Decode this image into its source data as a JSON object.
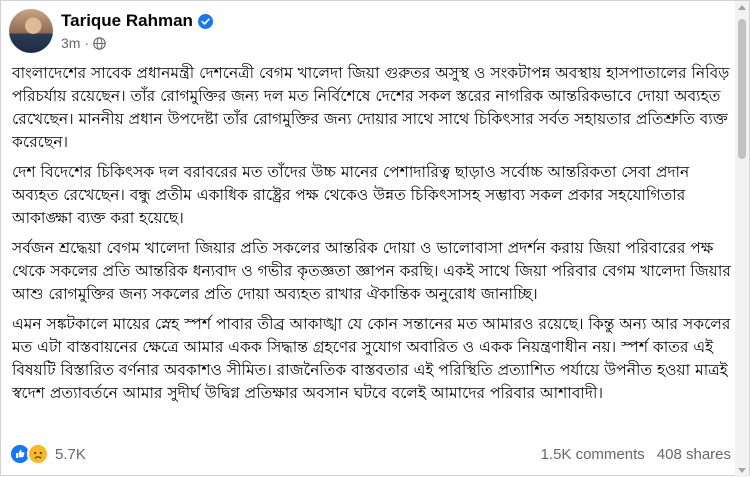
{
  "post": {
    "author": "Tarique Rahman",
    "time": "3m",
    "separator": "·",
    "paragraphs": [
      "বাংলাদেশের সাবেক প্রধানমন্ত্রী দেশনেত্রী বেগম খালেদা জিয়া গুরুতর অসুস্থ ও সংকটাপন্ন অবস্থায় হাসপাতালের নিবিড় পরিচর্যায় রয়েছেন। তাঁর রোগমুক্তির জন্য দল মত নির্বিশেষে দেশের সকল স্তরের নাগরিক আন্তরিকভাবে দোয়া অব্যহত রেখেছেন। মাননীয় প্রধান উপদেষ্টা তাঁর রোগমুক্তির জন্য দোয়ার সাথে সাথে চিকিৎসার সর্বত সহায়তার প্রতিশ্রুতি ব্যক্ত করেছেন।",
      "দেশ বিদেশের চিকিৎসক দল বরাবরের মত তাঁদের উচ্চ মানের পেশাদারিত্ব ছাড়াও সর্বোচ্চ আন্তরিকতা সেবা প্রদান অব্যহত রেখেছেন। বন্ধু প্রতীম একাধিক রাষ্ট্রের পক্ষ থেকেও উন্নত চিকিৎসাসহ সম্ভাব্য সকল প্রকার সহযোগিতার আকাঙ্ক্ষা ব্যক্ত করা হয়েছে।",
      "সর্বজন শ্রদ্ধেয়া বেগম খালেদা জিয়ার প্রতি সকলের আন্তরিক দোয়া ও ভালোবাসা প্রদর্শন করায় জিয়া পরিবারের পক্ষ থেকে সকলের প্রতি আন্তরিক ধন্যবাদ ও গভীর কৃতজ্ঞতা জ্ঞাপন করছি। একই সাথে জিয়া পরিবার বেগম খালেদা জিয়ার আশু রোগমুক্তির জন্য সকলের প্রতি দোয়া অব্যহত রাখার ঐকান্তিক অনুরোধ জানাচ্ছি।",
      "এমন সঙ্কটকালে মায়ের স্নেহ স্পর্শ পাবার তীব্র আকাঙ্খা যে কোন সন্তানের মত আমারও রয়েছে। কিন্তু অন্য আর সকলের মত এটা বাস্তবায়নের ক্ষেত্রে আমার একক সিদ্ধান্ত গ্রহণের সুযোগ অবারিত ও একক নিয়ন্ত্রণাধীন নয়। স্পর্শ কাতর এই বিষয়টি বিস্তারিত বর্ণনার অবকাশও সীমিত। রাজনৈতিক বাস্তবতার এই পরিস্থিতি প্রত্যাশিত পর্যায়ে উপনীত হওয়া মাত্রই স্বদেশ প্রত্যাবর্তনে আমার সুদীর্ঘ উদ্বিগ্ন প্রতিক্ষার অবসান ঘটবে বলেই আমাদের পরিবার আশাবাদী।"
    ]
  },
  "footer": {
    "reactions_count": "5.7K",
    "comments": "1.5K comments",
    "shares": "408 shares"
  },
  "icons": {
    "verified": "verified-badge-icon",
    "audience": "globe-icon",
    "reactions": [
      "like-reaction-icon",
      "sad-reaction-icon"
    ]
  },
  "colors": {
    "verified": "#1877f2",
    "meta_text": "#65676b",
    "like": "#1877f2",
    "sad": "#f7b928"
  }
}
